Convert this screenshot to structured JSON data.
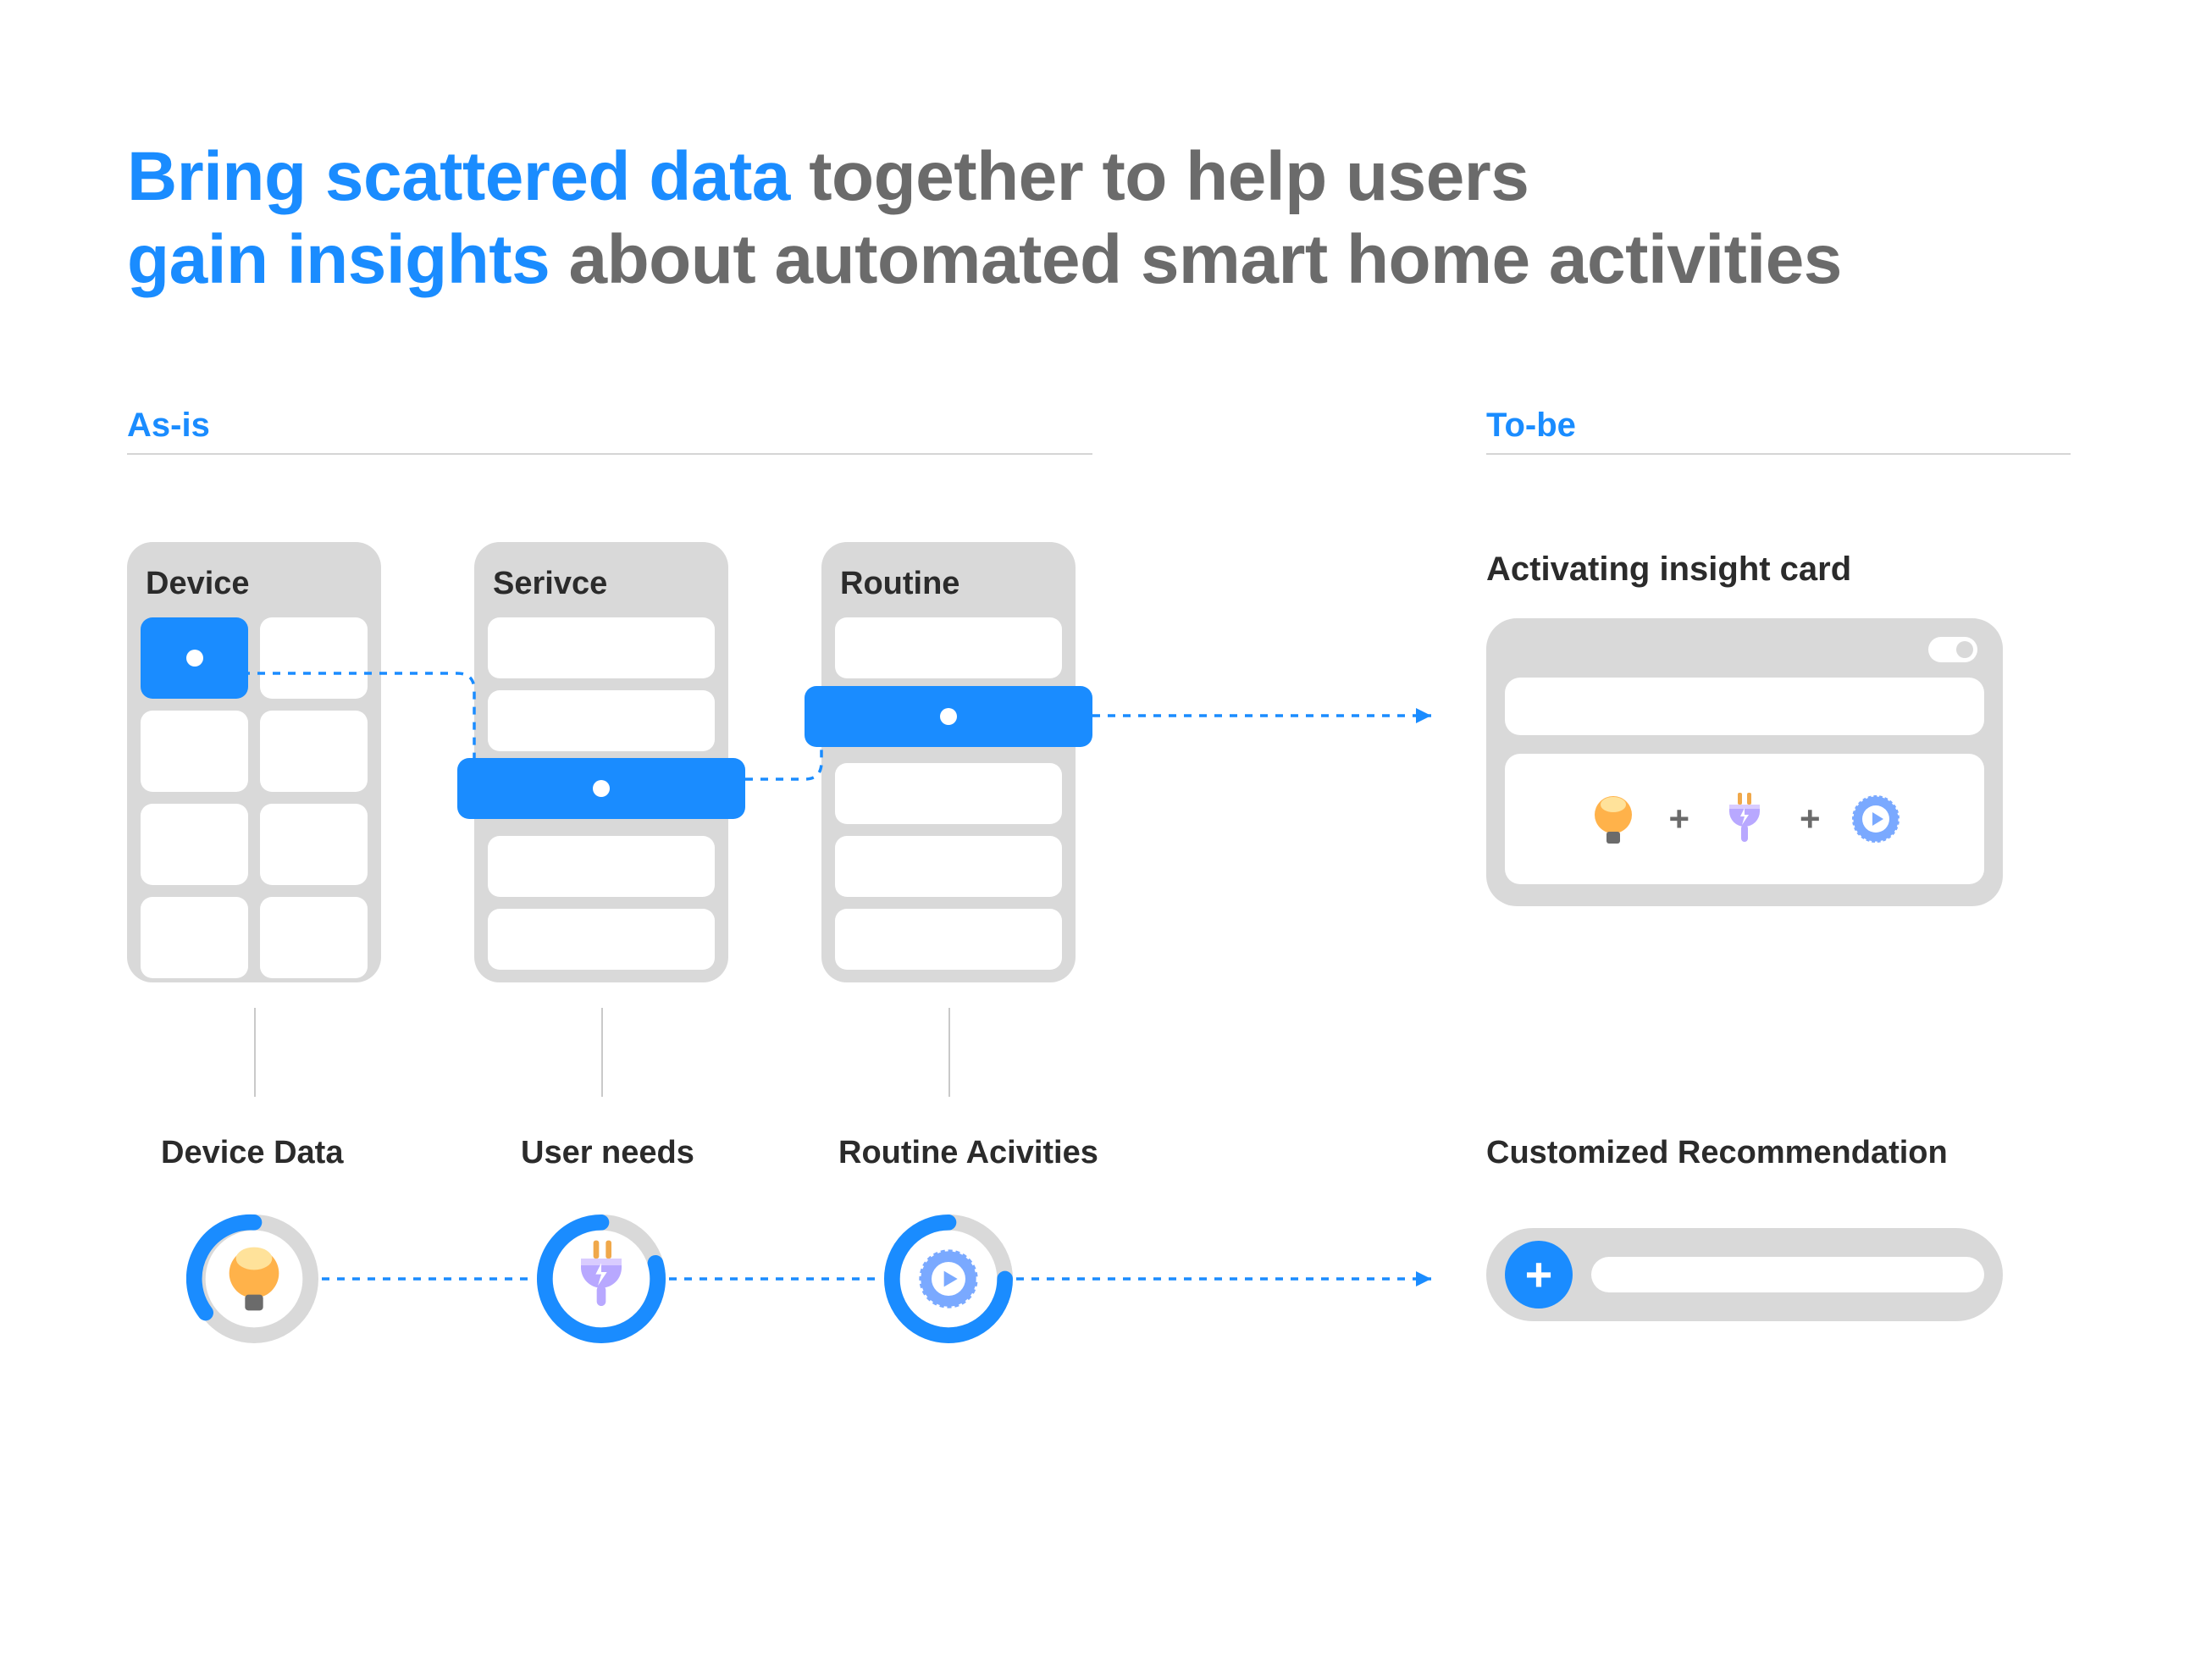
{
  "heading": {
    "highlight1": "Bring scattered data",
    "plain1": " together to help users ",
    "highlight2": "gain insights",
    "plain2": " about automated smart home activities"
  },
  "sections": {
    "asis": "As-is",
    "tobe": "To-be"
  },
  "phones": {
    "device": "Device",
    "service": "Serivce",
    "routine": "Routine"
  },
  "bottom": {
    "deviceData": "Device Data",
    "userNeeds": "User needs",
    "routineAct": "Routine Acivities",
    "customRec": "Customized Recommendation"
  },
  "tobe": {
    "cardTitle": "Activating insight card",
    "plus": "+"
  },
  "icons": {
    "bulb": "bulb-icon",
    "plug": "plug-icon",
    "play": "play-ring-icon",
    "add": "add-icon",
    "toggle": "toggle-icon"
  },
  "colors": {
    "accent": "#1a8cff",
    "grey": "#d9d9d9",
    "text": "#2b2b2b",
    "muted": "#6b6b6b"
  }
}
